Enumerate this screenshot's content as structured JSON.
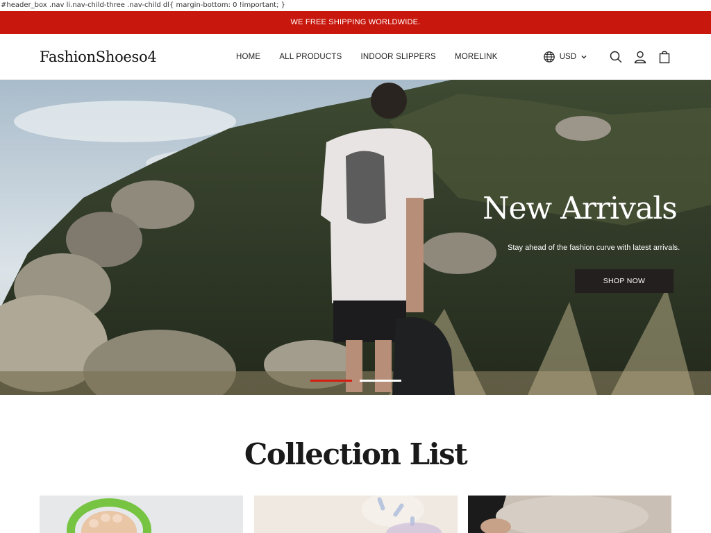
{
  "debug_css_text": "#header_box .nav li.nav-child-three .nav-child dl{ margin-bottom: 0 !important; }",
  "announcement": {
    "text": "WE FREE SHIPPING WORLDWIDE."
  },
  "header": {
    "logo": "FashionShoeso4",
    "nav": [
      {
        "label": "HOME"
      },
      {
        "label": "ALL PRODUCTS"
      },
      {
        "label": "INDOOR SLIPPERS"
      },
      {
        "label": "MORELINK"
      }
    ],
    "currency": "USD",
    "icons": [
      "globe-icon",
      "chevron-down-icon",
      "search-icon",
      "account-icon",
      "cart-icon"
    ]
  },
  "hero": {
    "title": "New Arrivals",
    "subtitle": "Stay ahead of the fashion curve with latest arrivals.",
    "button_label": "SHOP NOW",
    "slides_total": 2,
    "active_slide": 1
  },
  "collections": {
    "title": "Collection List"
  },
  "colors": {
    "announcement_bg": "#c8180e",
    "button_bg": "#231f1e",
    "active_indicator": "#d31d12"
  }
}
